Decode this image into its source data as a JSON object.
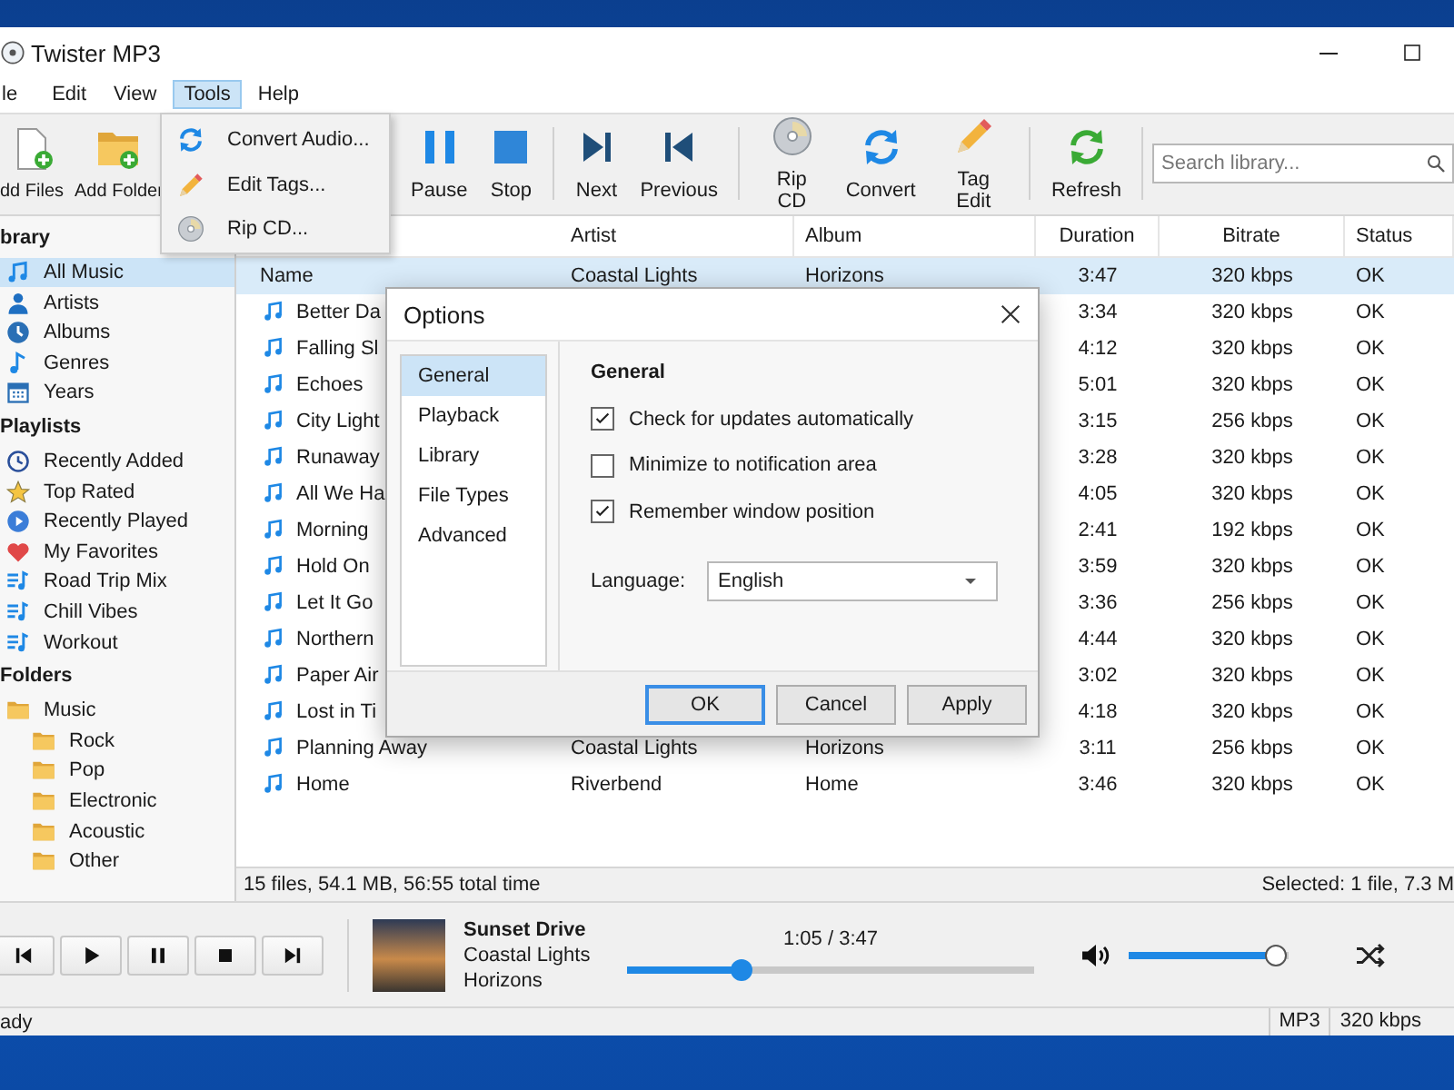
{
  "window": {
    "title": "Twister MP3"
  },
  "menu": [
    {
      "label": "le",
      "selected": false
    },
    {
      "label": "Edit",
      "selected": false
    },
    {
      "label": "View",
      "selected": false
    },
    {
      "label": "Tools",
      "selected": true
    },
    {
      "label": "Help",
      "selected": false
    }
  ],
  "tools_menu": [
    "Convert Audio...",
    "Edit Tags...",
    "Rip CD..."
  ],
  "toolbar": [
    [
      "dd Files",
      "Add Folder"
    ],
    [
      "Pause",
      "Stop"
    ],
    [
      "Next",
      "Previous"
    ],
    [
      "Rip CD",
      "Convert",
      "Tag Edit"
    ],
    [
      "Refresh"
    ]
  ],
  "search": {
    "placeholder": "Search library..."
  },
  "sidebar": [
    {
      "heading": "brary",
      "items": [
        {
          "label": "All Music",
          "selected": true
        },
        {
          "label": "Artists",
          "selected": false
        },
        {
          "label": "Albums",
          "selected": false
        },
        {
          "label": "Genres",
          "selected": false
        },
        {
          "label": "Years",
          "selected": false
        }
      ]
    },
    {
      "heading": "Playlists",
      "items": [
        {
          "label": "Recently Added",
          "selected": false
        },
        {
          "label": "Top Rated",
          "selected": false
        },
        {
          "label": "Recently Played",
          "selected": false
        },
        {
          "label": "My Favorites",
          "selected": false
        },
        {
          "label": "Road Trip Mix",
          "selected": false
        },
        {
          "label": "Chill Vibes",
          "selected": false
        },
        {
          "label": "Workout",
          "selected": false
        }
      ]
    },
    {
      "heading": "Folders",
      "items": [
        {
          "label": "Music",
          "selected": false,
          "children": [
            {
              "label": "Rock",
              "selected": false
            },
            {
              "label": "Pop",
              "selected": false
            },
            {
              "label": "Electronic",
              "selected": false
            },
            {
              "label": "Acoustic",
              "selected": false
            },
            {
              "label": "Other",
              "selected": false
            }
          ]
        }
      ]
    }
  ],
  "table": {
    "columns": [
      "Artist",
      "Album",
      "Duration",
      "Bitrate",
      "Status"
    ],
    "rows": [
      {
        "kind": "plain",
        "name": "Name",
        "artist": "Coastal Lights",
        "album": "Horizons",
        "duration": "3:47",
        "bitrate": "320 kbps",
        "status": "OK",
        "selected": true
      },
      {
        "kind": "track",
        "name": "Better Da",
        "duration": "3:34",
        "bitrate": "320 kbps",
        "status": "OK",
        "selected": false
      },
      {
        "kind": "track",
        "name": "Falling Sl",
        "duration": "4:12",
        "bitrate": "320 kbps",
        "status": "OK",
        "selected": false
      },
      {
        "kind": "track",
        "name": "Echoes",
        "duration": "5:01",
        "bitrate": "320 kbps",
        "status": "OK",
        "selected": false
      },
      {
        "kind": "track",
        "name": "City Light",
        "duration": "3:15",
        "bitrate": "256 kbps",
        "status": "OK",
        "selected": false
      },
      {
        "kind": "track",
        "name": "Runaway",
        "duration": "3:28",
        "bitrate": "320 kbps",
        "status": "OK",
        "selected": false
      },
      {
        "kind": "track",
        "name": "All We Ha",
        "duration": "4:05",
        "bitrate": "320 kbps",
        "status": "OK",
        "selected": false
      },
      {
        "kind": "track",
        "name": "Morning",
        "duration": "2:41",
        "bitrate": "192 kbps",
        "status": "OK",
        "selected": false
      },
      {
        "kind": "track",
        "name": "Hold On",
        "duration": "3:59",
        "bitrate": "320 kbps",
        "status": "OK",
        "selected": false
      },
      {
        "kind": "track",
        "name": "Let It Go",
        "duration": "3:36",
        "bitrate": "256 kbps",
        "status": "OK",
        "selected": false
      },
      {
        "kind": "track",
        "name": "Northern",
        "duration": "4:44",
        "bitrate": "320 kbps",
        "status": "OK",
        "selected": false
      },
      {
        "kind": "track",
        "name": "Paper Air",
        "duration": "3:02",
        "bitrate": "320 kbps",
        "status": "OK",
        "selected": false
      },
      {
        "kind": "track",
        "name": "Lost in Ti",
        "duration": "4:18",
        "bitrate": "320 kbps",
        "status": "OK",
        "selected": false
      },
      {
        "kind": "track",
        "name": "Planning Away",
        "artist": "Coastal Lights",
        "album": "Horizons",
        "duration": "3:11",
        "bitrate": "256 kbps",
        "status": "OK",
        "selected": false
      },
      {
        "kind": "track",
        "name": "Home",
        "artist": "Riverbend",
        "album": "Home",
        "duration": "3:46",
        "bitrate": "320 kbps",
        "status": "OK",
        "selected": false
      }
    ]
  },
  "status_bar": {
    "summary": "15 files, 54.1 MB, 56:55 total time",
    "selection": "Selected: 1 file, 7.3 M"
  },
  "player": {
    "title": "Sunset Drive",
    "artist": "Coastal Lights",
    "album": "Horizons",
    "time": "1:05 / 3:47",
    "progress": {
      "level": 0.28
    },
    "volume": {
      "level": 0.92
    }
  },
  "footer": {
    "status": "ady",
    "format": "MP3",
    "bitrate": "320 kbps"
  },
  "dialog": {
    "title": "Options",
    "nav": [
      {
        "label": "General",
        "selected": true
      },
      {
        "label": "Playback",
        "selected": false
      },
      {
        "label": "Library",
        "selected": false
      },
      {
        "label": "File Types",
        "selected": false
      },
      {
        "label": "Advanced",
        "selected": false
      }
    ],
    "heading": "General",
    "options": [
      {
        "label": "Check for updates automatically",
        "checked": true
      },
      {
        "label": "Minimize to notification area",
        "checked": false
      },
      {
        "label": "Remember window position",
        "checked": true
      }
    ],
    "language": {
      "label": "Language:",
      "value": "English"
    },
    "buttons": [
      {
        "label": "OK",
        "default": true
      },
      {
        "label": "Cancel",
        "default": false
      },
      {
        "label": "Apply",
        "default": false
      }
    ]
  }
}
